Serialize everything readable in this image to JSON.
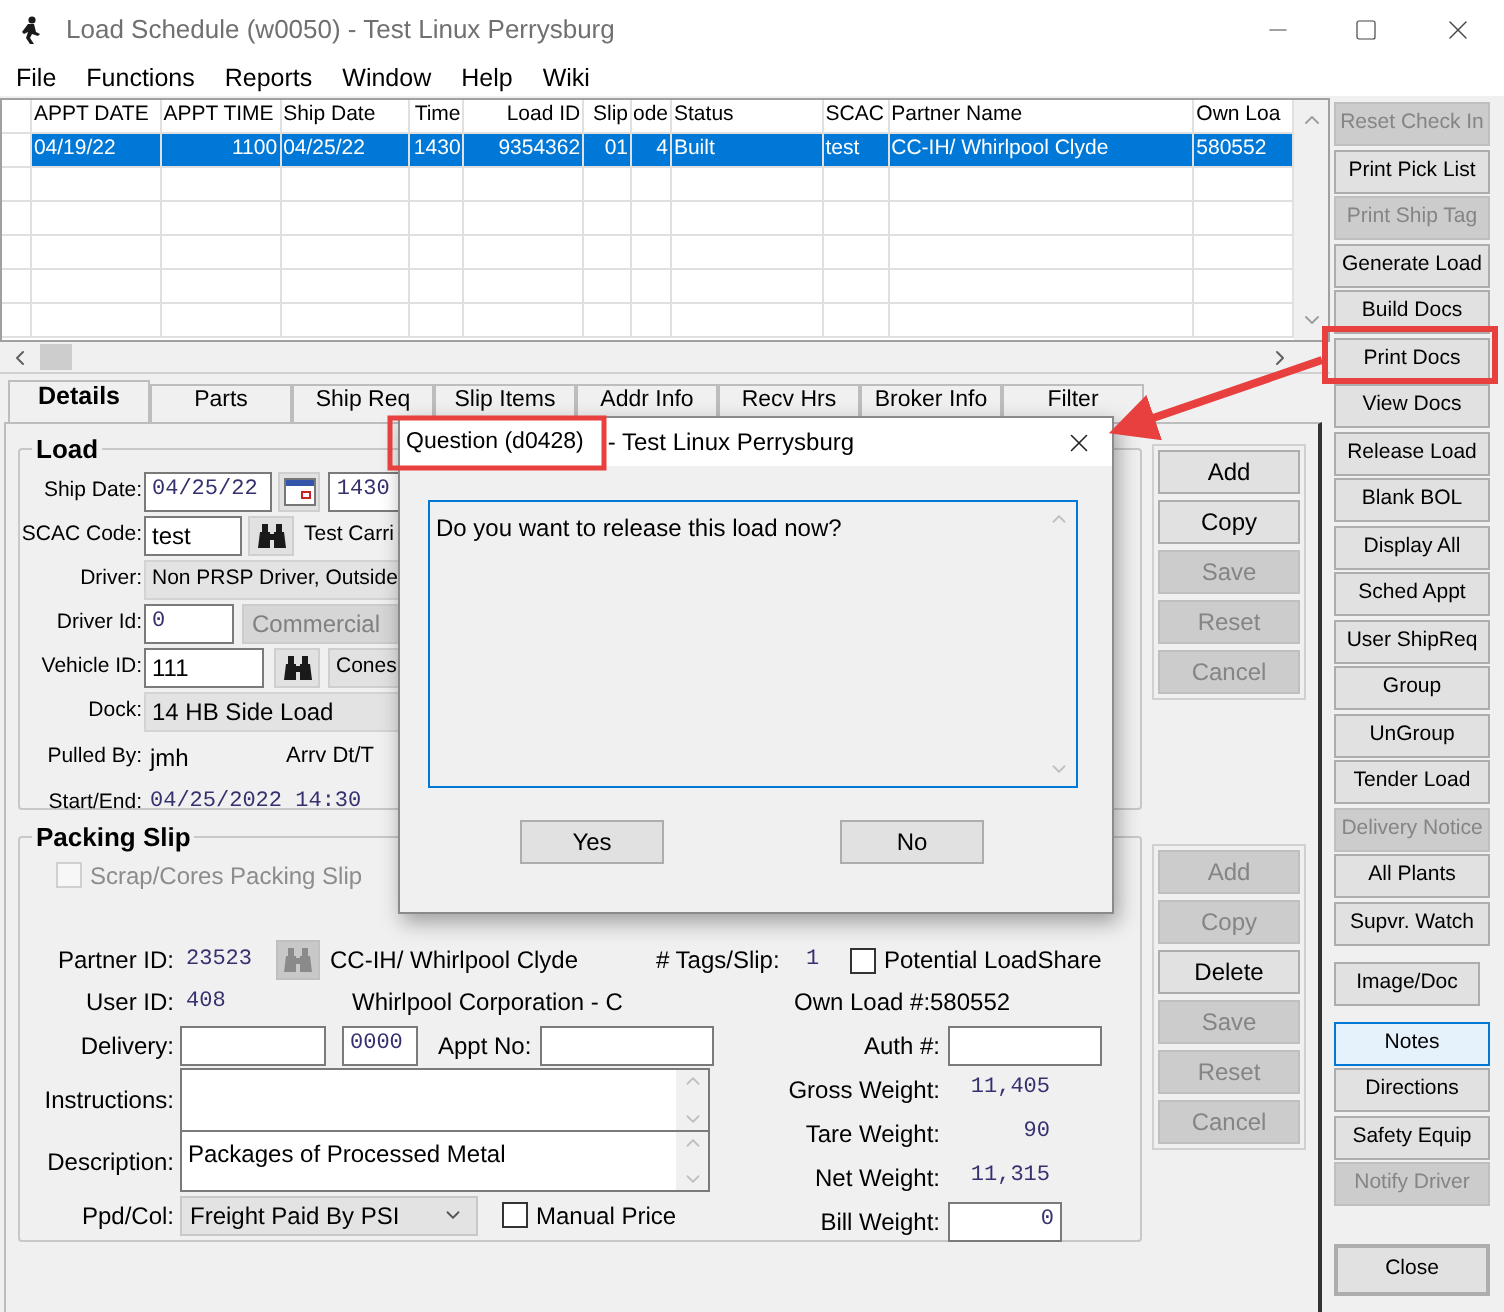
{
  "window": {
    "title": "Load Schedule (w0050) - Test Linux Perrysburg"
  },
  "menu": [
    "File",
    "Functions",
    "Reports",
    "Window",
    "Help",
    "Wiki"
  ],
  "grid": {
    "columns": [
      "APPT DATE",
      "APPT TIME",
      "Ship Date",
      "Time",
      "Load ID",
      "Slip",
      "ode",
      "Status",
      "SCAC",
      "Partner Name",
      "Own Loa"
    ],
    "rows": [
      {
        "selected": true,
        "cells": [
          "04/19/22",
          "1100",
          "04/25/22",
          "1430",
          "9354362",
          "01",
          "4",
          "Built",
          "test",
          "CC-IH/ Whirlpool Clyde",
          "580552"
        ]
      }
    ]
  },
  "side_button_groups": [
    [
      {
        "label": "Reset Check In",
        "disabled": true,
        "focused": false
      },
      {
        "label": "Print Pick List",
        "disabled": false,
        "focused": false
      },
      {
        "label": "Print Ship Tag",
        "disabled": true,
        "focused": false
      },
      {
        "label": "Generate Load",
        "disabled": false,
        "focused": false
      },
      {
        "label": "Build Docs",
        "disabled": false,
        "focused": false
      },
      {
        "label": "Print Docs",
        "disabled": false,
        "focused": false
      },
      {
        "label": "View Docs",
        "disabled": false,
        "focused": false
      },
      {
        "label": "Release Load",
        "disabled": false,
        "focused": false
      },
      {
        "label": "Blank BOL",
        "disabled": false,
        "focused": false
      },
      {
        "label": "Display All",
        "disabled": false,
        "focused": false
      },
      {
        "label": "Sched Appt",
        "disabled": false,
        "focused": false
      },
      {
        "label": "User ShipReq",
        "disabled": false,
        "focused": false
      },
      {
        "label": "Group",
        "disabled": false,
        "focused": false
      },
      {
        "label": "UnGroup",
        "disabled": false,
        "focused": false
      },
      {
        "label": "Tender Load",
        "disabled": false,
        "focused": false
      },
      {
        "label": "Delivery Notice",
        "disabled": true,
        "focused": false
      },
      {
        "label": "All Plants",
        "disabled": false,
        "focused": false
      },
      {
        "label": "Supvr. Watch",
        "disabled": false,
        "focused": false
      }
    ],
    [
      {
        "label": "Image/Doc",
        "disabled": false,
        "focused": false
      }
    ],
    [
      {
        "label": "Notes",
        "disabled": false,
        "focused": true
      },
      {
        "label": "Directions",
        "disabled": false,
        "focused": false
      },
      {
        "label": "Safety Equip",
        "disabled": false,
        "focused": false
      },
      {
        "label": "Notify Driver",
        "disabled": true,
        "focused": false
      }
    ],
    [
      {
        "label": "Close",
        "disabled": false,
        "focused": false
      }
    ]
  ],
  "tabs": [
    {
      "label": "Details",
      "selected": true
    },
    {
      "label": "Parts",
      "selected": false
    },
    {
      "label": "Ship Req",
      "selected": false
    },
    {
      "label": "Slip Items",
      "selected": false
    },
    {
      "label": "Addr Info",
      "selected": false
    },
    {
      "label": "Recv Hrs",
      "selected": false
    },
    {
      "label": "Broker Info",
      "selected": false
    },
    {
      "label": "Filter",
      "selected": false
    }
  ],
  "load": {
    "title": "Load",
    "ship_date_label": "Ship Date:",
    "ship_date": "04/25/22",
    "ship_time": "1430",
    "scac_label": "SCAC Code:",
    "scac": "test",
    "scac_lookup": {
      "disabled": false
    },
    "carrier": "Test Carri",
    "driver_label": "Driver:",
    "driver": "Non PRSP Driver, Outside",
    "driver_id_label": "Driver Id:",
    "driver_id": "0",
    "driver_type": "Commercial",
    "vehicle_label": "Vehicle ID:",
    "vehicle_id": "111",
    "vehicle_lookup": {
      "disabled": false
    },
    "vehicle_button": "Cones",
    "dock_label": "Dock:",
    "dock": "14 HB Side Load",
    "pulled_by_label": "Pulled By:",
    "pulled_by": "jmh",
    "arrival_label": "Arrv Dt/T",
    "start_end_label": "Start/End:",
    "start_end": "04/25/2022 14:30"
  },
  "load_buttons": [
    {
      "label": "Add",
      "disabled": false
    },
    {
      "label": "Copy",
      "disabled": false
    },
    {
      "label": "Save",
      "disabled": true
    },
    {
      "label": "Reset",
      "disabled": true
    },
    {
      "label": "Cancel",
      "disabled": true
    }
  ],
  "packing_slip": {
    "title": "Packing Slip",
    "scrap_checkbox": {
      "label": "Scrap/Cores Packing Slip",
      "checked": false,
      "disabled": true
    },
    "partner_id_label": "Partner ID:",
    "partner_id": "23523",
    "partner_lookup": {
      "disabled": true
    },
    "partner_name": "CC-IH/ Whirlpool Clyde",
    "tags_label": "# Tags/Slip:",
    "tags": "1",
    "loadshare_checkbox": {
      "label": "Potential LoadShare",
      "checked": false,
      "disabled": false
    },
    "user_id_label": "User ID:",
    "user_id": "408",
    "company": "Whirlpool Corporation - C",
    "own_load_label": "Own Load #:",
    "own_load": "580552",
    "delivery_label": "Delivery:",
    "delivery_time": "0000",
    "appt_label": "Appt No:",
    "auth_label": "Auth #:",
    "instructions_label": "Instructions:",
    "description_label": "Description:",
    "description": "Packages of Processed Metal",
    "ppd_label": "Ppd/Col:",
    "ppd": "Freight Paid By PSI",
    "manual_price_checkbox": {
      "label": "Manual Price",
      "checked": false,
      "disabled": false
    },
    "weights": [
      {
        "label": "Gross Weight:",
        "value": "11,405"
      },
      {
        "label": "Tare Weight:",
        "value": "90"
      },
      {
        "label": "Net Weight:",
        "value": "11,315"
      }
    ],
    "bill_weight_label": "Bill Weight:",
    "bill_weight": "0"
  },
  "packing_buttons": [
    {
      "label": "Add",
      "disabled": true
    },
    {
      "label": "Copy",
      "disabled": true
    },
    {
      "label": "Delete",
      "disabled": false
    },
    {
      "label": "Save",
      "disabled": true
    },
    {
      "label": "Reset",
      "disabled": true
    },
    {
      "label": "Cancel",
      "disabled": true
    }
  ],
  "dialog": {
    "title": "Question (d0428)",
    "subtitle": "- Test Linux Perrysburg",
    "message": "Do you want to release this load now?",
    "buttons": [
      "Yes",
      "No"
    ]
  }
}
